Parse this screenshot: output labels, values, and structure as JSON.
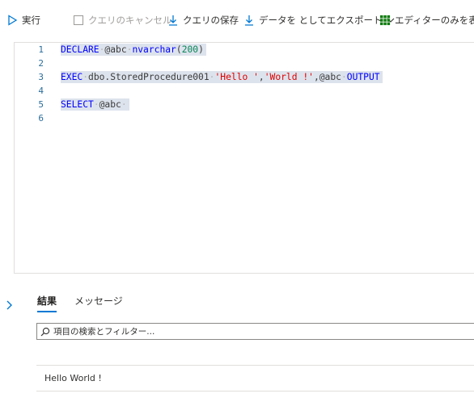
{
  "toolbar": {
    "run_label": "実行",
    "cancel_label": "クエリのキャンセル",
    "save_label": "クエリの保存",
    "export_label": "データを としてエクスポート",
    "editor_only_label": "エディターのみを表示"
  },
  "editor": {
    "lines": [
      {
        "number": "1",
        "tokens": [
          "DECLARE",
          " ",
          "@abc",
          " ",
          "nvarchar",
          "(",
          "200",
          ")"
        ]
      },
      {
        "number": "2",
        "tokens": []
      },
      {
        "number": "3",
        "tokens": [
          "EXEC",
          " ",
          "dbo.StoredProcedure001",
          " ",
          "'Hello '",
          ",",
          "'World !'",
          ",",
          "@abc",
          " ",
          "OUTPUT"
        ]
      },
      {
        "number": "4",
        "tokens": []
      },
      {
        "number": "5",
        "tokens": [
          "SELECT",
          " ",
          "@abc",
          " "
        ]
      },
      {
        "number": "6",
        "tokens": []
      }
    ]
  },
  "results": {
    "tabs": [
      "結果",
      "メッセージ"
    ],
    "filter_placeholder": "項目の検索とフィルター...",
    "rows": [
      "Hello World !"
    ]
  },
  "colors": {
    "accent": "#0078d4",
    "keyword": "#0000ff",
    "string": "#e00000",
    "number": "#098658",
    "line_number": "#2b6e9b",
    "selection": "#dde3ec"
  }
}
